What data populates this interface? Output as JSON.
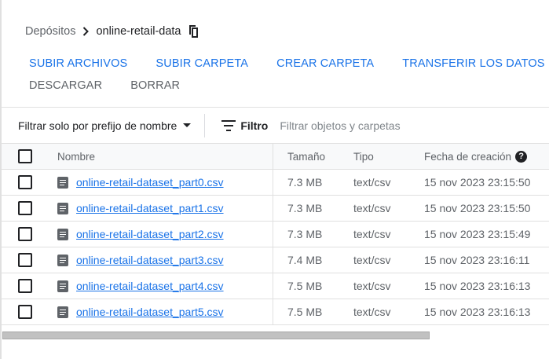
{
  "breadcrumb": {
    "root": "Depósitos",
    "separator_icon": "chevron-right-icon",
    "current": "online-retail-data",
    "copy_icon": "copy-icon"
  },
  "actions": {
    "upload_files": "SUBIR ARCHIVOS",
    "upload_folder": "SUBIR CARPETA",
    "create_folder": "CREAR CARPETA",
    "transfer_data": "TRANSFERIR LOS DATOS",
    "download": "DESCARGAR",
    "delete": "BORRAR"
  },
  "filter": {
    "prefix_dropdown": "Filtrar solo por prefijo de nombre",
    "label": "Filtro",
    "placeholder": "Filtrar objetos y carpetas"
  },
  "table": {
    "columns": {
      "name": "Nombre",
      "size": "Tamaño",
      "type": "Tipo",
      "created": "Fecha de creación"
    },
    "rows": [
      {
        "name": "online-retail-dataset_part0.csv",
        "size": "7.3 MB",
        "type": "text/csv",
        "created": "15 nov 2023 23:15:50"
      },
      {
        "name": "online-retail-dataset_part1.csv",
        "size": "7.3 MB",
        "type": "text/csv",
        "created": "15 nov 2023 23:15:50"
      },
      {
        "name": "online-retail-dataset_part2.csv",
        "size": "7.3 MB",
        "type": "text/csv",
        "created": "15 nov 2023 23:15:49"
      },
      {
        "name": "online-retail-dataset_part3.csv",
        "size": "7.4 MB",
        "type": "text/csv",
        "created": "15 nov 2023 23:16:11"
      },
      {
        "name": "online-retail-dataset_part4.csv",
        "size": "7.5 MB",
        "type": "text/csv",
        "created": "15 nov 2023 23:16:13"
      },
      {
        "name": "online-retail-dataset_part5.csv",
        "size": "7.5 MB",
        "type": "text/csv",
        "created": "15 nov 2023 23:16:13"
      }
    ]
  },
  "colors": {
    "accent": "#1a73e8",
    "text": "#202124",
    "muted": "#5f6368"
  }
}
